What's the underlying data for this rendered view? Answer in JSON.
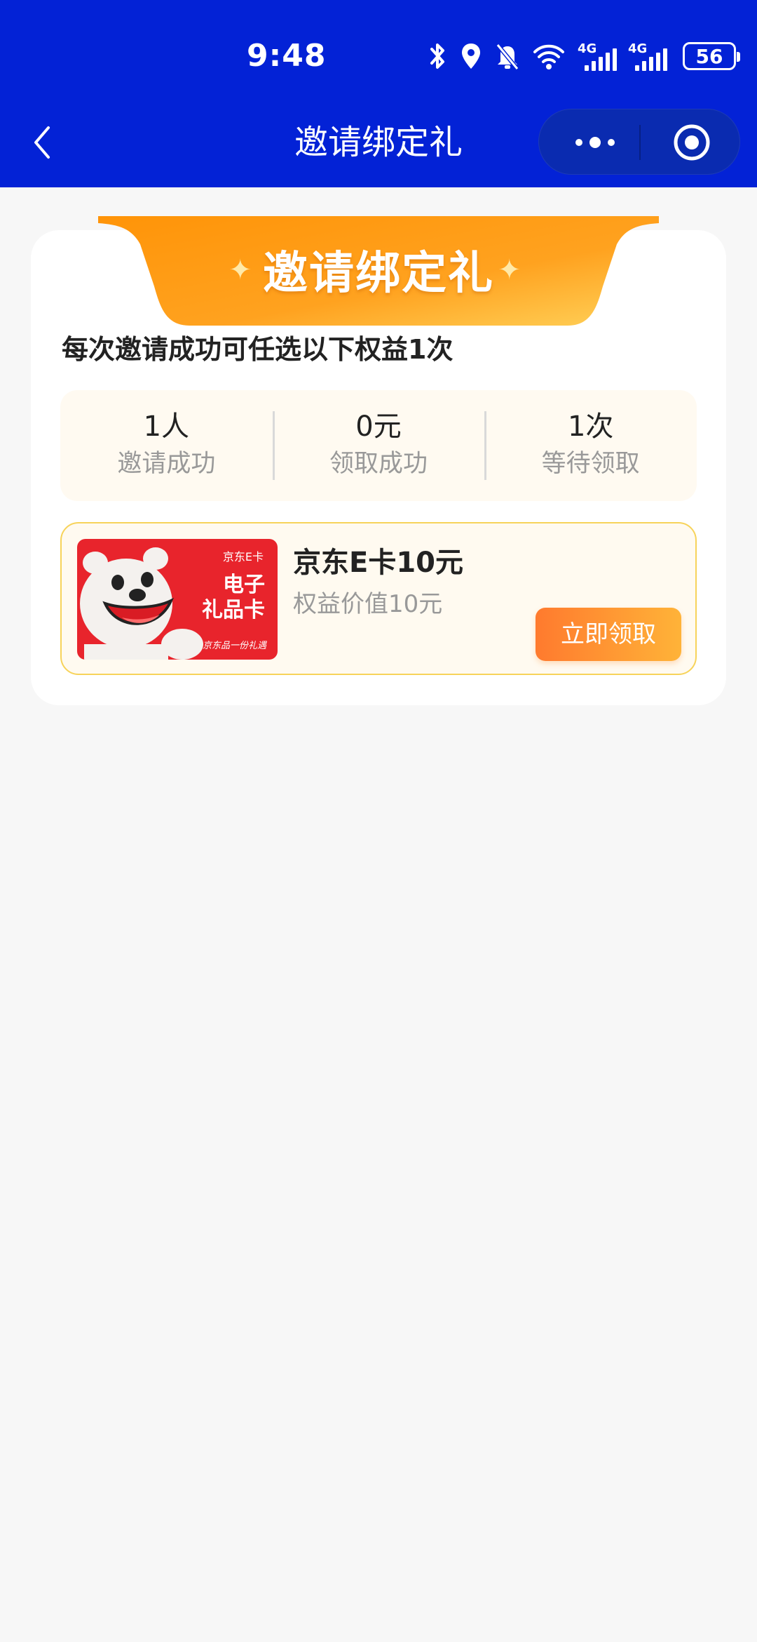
{
  "status_bar": {
    "time": "9:48",
    "network_1": "4G",
    "network_2": "4G",
    "battery": "56",
    "icons": [
      "bluetooth-icon",
      "location-icon",
      "bell-muted-icon",
      "wifi-icon",
      "signal-icon",
      "battery-icon"
    ]
  },
  "nav": {
    "title": "邀请绑定礼",
    "back_icon": "chevron-left-icon",
    "more_icon": "more-dots-icon",
    "close_icon": "target-close-icon"
  },
  "banner": {
    "title": "邀请绑定礼"
  },
  "subtitle": "每次邀请成功可任选以下权益1次",
  "stats": [
    {
      "value": "1人",
      "label": "邀请成功"
    },
    {
      "value": "0元",
      "label": "领取成功"
    },
    {
      "value": "1次",
      "label": "等待领取"
    }
  ],
  "reward": {
    "image": {
      "brand": "京东E卡",
      "line1": "电子",
      "line2": "礼品卡",
      "slogan": "京东品一份礼遇"
    },
    "title": "京东E卡10元",
    "subtitle": "权益价值10元",
    "button": "立即领取"
  },
  "colors": {
    "header": "#0322d6",
    "accent_orange": "#ff9a1a",
    "button_start": "#ff7a2e",
    "button_end": "#ffb338",
    "card_border": "#f7d35a",
    "gift_red": "#e8242c"
  }
}
